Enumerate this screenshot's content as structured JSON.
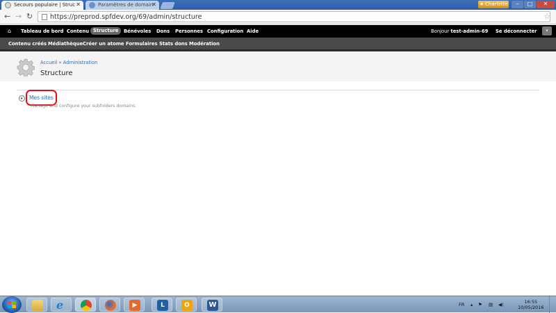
{
  "browser": {
    "tabs": [
      {
        "title": "Secours populaire | Struc"
      },
      {
        "title": "Paramètres de domain"
      }
    ],
    "tab_close_glyph": "✕",
    "user_badge": "Charlotte",
    "url": "https://preprod.spfdev.org/69/admin/structure",
    "icons": [
      "back-icon",
      "forward-icon",
      "reload-icon",
      "star-icon",
      "extension-icon",
      "menu-icon"
    ]
  },
  "admin_toolbar": {
    "items": [
      "Tableau de bord",
      "Contenu",
      "Structure",
      "Bénévoles",
      "Dons",
      "Personnes",
      "Configuration",
      "Aide"
    ],
    "active": "Structure",
    "greeting_prefix": "Bonjour ",
    "username": "test-admin-69",
    "logout": "Se déconnecter"
  },
  "shortcuts": [
    "Contenu créés",
    "Médiathèque",
    "Créer un atome",
    "Formulaires",
    "Stats dons",
    "Modération"
  ],
  "page": {
    "breadcrumb": "Accueil » Administration",
    "title": "Structure",
    "items": [
      {
        "label": "Mes sites",
        "description": "Manage and configure your subfolders domains."
      }
    ]
  },
  "taskbar": {
    "apps": [
      "explorer",
      "internet-explorer",
      "chrome",
      "firefox",
      "media",
      "lync",
      "outlook",
      "word"
    ],
    "lang": "FR",
    "time": "16:55",
    "date": "10/05/2016"
  },
  "colors": {
    "link": "#2a6ebb",
    "highlight": "#e0101a",
    "admin_bar": "#000000",
    "shortcut_bar": "#4a4a4a"
  }
}
